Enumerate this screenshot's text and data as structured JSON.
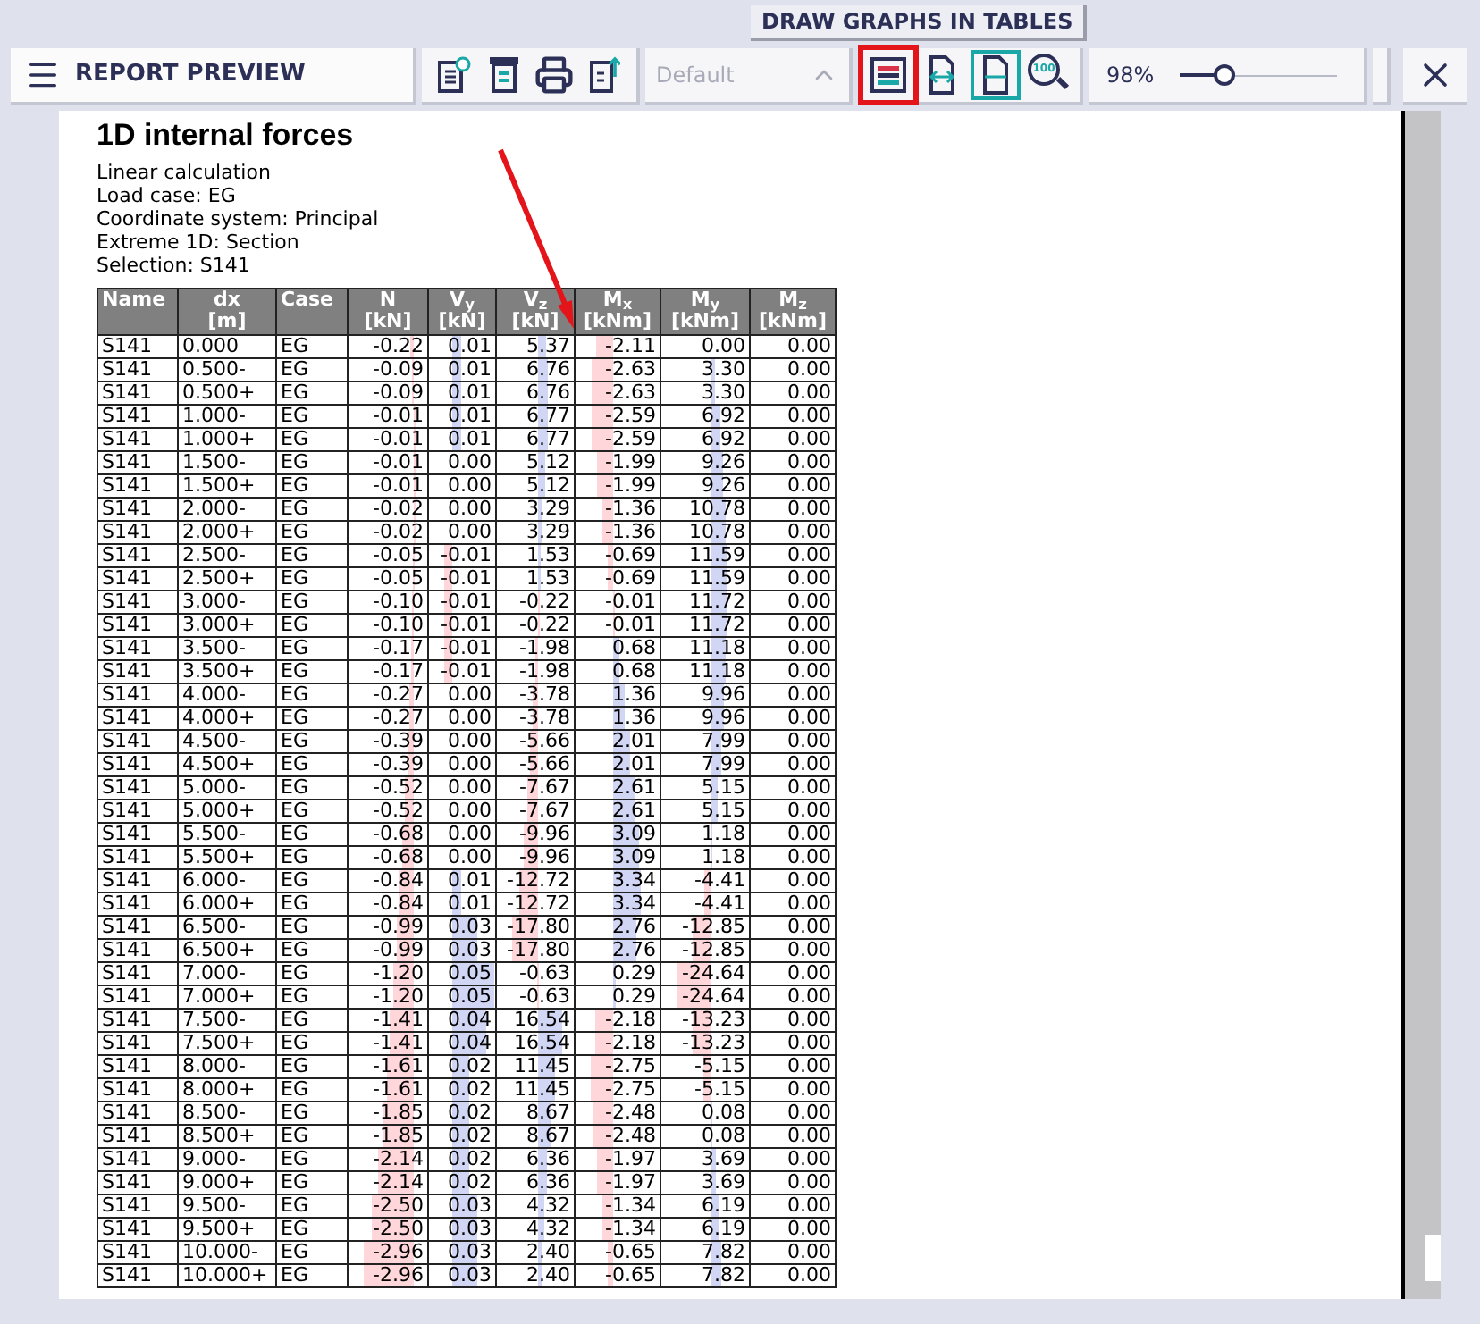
{
  "tooltip": "DRAW GRAPHS IN TABLES",
  "toolbar": {
    "title": "REPORT PREVIEW",
    "file_buttons": [
      {
        "kind": "doc-settings"
      },
      {
        "kind": "table-doc"
      },
      {
        "kind": "print"
      },
      {
        "kind": "export"
      }
    ],
    "template": {
      "value": "Default",
      "disabled": true
    },
    "view_buttons": [
      {
        "kind": "graph-table",
        "selected": false,
        "annotated": true
      },
      {
        "kind": "fit-width",
        "selected": false,
        "annotated": false
      },
      {
        "kind": "fit-page",
        "selected": true,
        "annotated": false
      },
      {
        "kind": "zoom-100",
        "label": "100",
        "selected": false,
        "annotated": false
      }
    ],
    "zoom": {
      "reading": "98%",
      "level": 0.29
    }
  },
  "report": {
    "title": "1D internal forces",
    "info": [
      "Linear calculation",
      "Load case: EG",
      "Coordinate system: Principal",
      "Extreme 1D: Section",
      "Selection: S141"
    ],
    "table": {
      "columns": [
        {
          "name": "Name"
        },
        {
          "name": "dx",
          "unit": "[m]"
        },
        {
          "name": "Case"
        },
        {
          "name": "N",
          "unit": "[kN]"
        },
        {
          "name": "V$_{y}$",
          "unit": "[kN]"
        },
        {
          "name": "V$_{z}$",
          "unit": "[kN]"
        },
        {
          "name": "M$_{x}$",
          "unit": "[kNm]"
        },
        {
          "name": "M$_{y}$",
          "unit": "[kNm]"
        },
        {
          "name": "M$_{z}$",
          "unit": "[kNm]"
        }
      ],
      "rows": [
        [
          "S141",
          "0.000",
          "EG",
          "-0.22",
          "0.01",
          "5.37",
          "-2.11",
          "0.00",
          "0.00"
        ],
        [
          "S141",
          "0.500-",
          "EG",
          "-0.09",
          "0.01",
          "6.76",
          "-2.63",
          "3.30",
          "0.00"
        ],
        [
          "S141",
          "0.500+",
          "EG",
          "-0.09",
          "0.01",
          "6.76",
          "-2.63",
          "3.30",
          "0.00"
        ],
        [
          "S141",
          "1.000-",
          "EG",
          "-0.01",
          "0.01",
          "6.77",
          "-2.59",
          "6.92",
          "0.00"
        ],
        [
          "S141",
          "1.000+",
          "EG",
          "-0.01",
          "0.01",
          "6.77",
          "-2.59",
          "6.92",
          "0.00"
        ],
        [
          "S141",
          "1.500-",
          "EG",
          "-0.01",
          "0.00",
          "5.12",
          "-1.99",
          "9.26",
          "0.00"
        ],
        [
          "S141",
          "1.500+",
          "EG",
          "-0.01",
          "0.00",
          "5.12",
          "-1.99",
          "9.26",
          "0.00"
        ],
        [
          "S141",
          "2.000-",
          "EG",
          "-0.02",
          "0.00",
          "3.29",
          "-1.36",
          "10.78",
          "0.00"
        ],
        [
          "S141",
          "2.000+",
          "EG",
          "-0.02",
          "0.00",
          "3.29",
          "-1.36",
          "10.78",
          "0.00"
        ],
        [
          "S141",
          "2.500-",
          "EG",
          "-0.05",
          "-0.01",
          "1.53",
          "-0.69",
          "11.59",
          "0.00"
        ],
        [
          "S141",
          "2.500+",
          "EG",
          "-0.05",
          "-0.01",
          "1.53",
          "-0.69",
          "11.59",
          "0.00"
        ],
        [
          "S141",
          "3.000-",
          "EG",
          "-0.10",
          "-0.01",
          "-0.22",
          "-0.01",
          "11.72",
          "0.00"
        ],
        [
          "S141",
          "3.000+",
          "EG",
          "-0.10",
          "-0.01",
          "-0.22",
          "-0.01",
          "11.72",
          "0.00"
        ],
        [
          "S141",
          "3.500-",
          "EG",
          "-0.17",
          "-0.01",
          "-1.98",
          "0.68",
          "11.18",
          "0.00"
        ],
        [
          "S141",
          "3.500+",
          "EG",
          "-0.17",
          "-0.01",
          "-1.98",
          "0.68",
          "11.18",
          "0.00"
        ],
        [
          "S141",
          "4.000-",
          "EG",
          "-0.27",
          "0.00",
          "-3.78",
          "1.36",
          "9.96",
          "0.00"
        ],
        [
          "S141",
          "4.000+",
          "EG",
          "-0.27",
          "0.00",
          "-3.78",
          "1.36",
          "9.96",
          "0.00"
        ],
        [
          "S141",
          "4.500-",
          "EG",
          "-0.39",
          "0.00",
          "-5.66",
          "2.01",
          "7.99",
          "0.00"
        ],
        [
          "S141",
          "4.500+",
          "EG",
          "-0.39",
          "0.00",
          "-5.66",
          "2.01",
          "7.99",
          "0.00"
        ],
        [
          "S141",
          "5.000-",
          "EG",
          "-0.52",
          "0.00",
          "-7.67",
          "2.61",
          "5.15",
          "0.00"
        ],
        [
          "S141",
          "5.000+",
          "EG",
          "-0.52",
          "0.00",
          "-7.67",
          "2.61",
          "5.15",
          "0.00"
        ],
        [
          "S141",
          "5.500-",
          "EG",
          "-0.68",
          "0.00",
          "-9.96",
          "3.09",
          "1.18",
          "0.00"
        ],
        [
          "S141",
          "5.500+",
          "EG",
          "-0.68",
          "0.00",
          "-9.96",
          "3.09",
          "1.18",
          "0.00"
        ],
        [
          "S141",
          "6.000-",
          "EG",
          "-0.84",
          "0.01",
          "-12.72",
          "3.34",
          "-4.41",
          "0.00"
        ],
        [
          "S141",
          "6.000+",
          "EG",
          "-0.84",
          "0.01",
          "-12.72",
          "3.34",
          "-4.41",
          "0.00"
        ],
        [
          "S141",
          "6.500-",
          "EG",
          "-0.99",
          "0.03",
          "-17.80",
          "2.76",
          "-12.85",
          "0.00"
        ],
        [
          "S141",
          "6.500+",
          "EG",
          "-0.99",
          "0.03",
          "-17.80",
          "2.76",
          "-12.85",
          "0.00"
        ],
        [
          "S141",
          "7.000-",
          "EG",
          "-1.20",
          "0.05",
          "-0.63",
          "0.29",
          "-24.64",
          "0.00"
        ],
        [
          "S141",
          "7.000+",
          "EG",
          "-1.20",
          "0.05",
          "-0.63",
          "0.29",
          "-24.64",
          "0.00"
        ],
        [
          "S141",
          "7.500-",
          "EG",
          "-1.41",
          "0.04",
          "16.54",
          "-2.18",
          "-13.23",
          "0.00"
        ],
        [
          "S141",
          "7.500+",
          "EG",
          "-1.41",
          "0.04",
          "16.54",
          "-2.18",
          "-13.23",
          "0.00"
        ],
        [
          "S141",
          "8.000-",
          "EG",
          "-1.61",
          "0.02",
          "11.45",
          "-2.75",
          "-5.15",
          "0.00"
        ],
        [
          "S141",
          "8.000+",
          "EG",
          "-1.61",
          "0.02",
          "11.45",
          "-2.75",
          "-5.15",
          "0.00"
        ],
        [
          "S141",
          "8.500-",
          "EG",
          "-1.85",
          "0.02",
          "8.67",
          "-2.48",
          "0.08",
          "0.00"
        ],
        [
          "S141",
          "8.500+",
          "EG",
          "-1.85",
          "0.02",
          "8.67",
          "-2.48",
          "0.08",
          "0.00"
        ],
        [
          "S141",
          "9.000-",
          "EG",
          "-2.14",
          "0.02",
          "6.36",
          "-1.97",
          "3.69",
          "0.00"
        ],
        [
          "S141",
          "9.000+",
          "EG",
          "-2.14",
          "0.02",
          "6.36",
          "-1.97",
          "3.69",
          "0.00"
        ],
        [
          "S141",
          "9.500-",
          "EG",
          "-2.50",
          "0.03",
          "4.32",
          "-1.34",
          "6.19",
          "0.00"
        ],
        [
          "S141",
          "9.500+",
          "EG",
          "-2.50",
          "0.03",
          "4.32",
          "-1.34",
          "6.19",
          "0.00"
        ],
        [
          "S141",
          "10.000-",
          "EG",
          "-2.96",
          "0.03",
          "2.40",
          "-0.65",
          "7.82",
          "0.00"
        ],
        [
          "S141",
          "10.000+",
          "EG",
          "-2.96",
          "0.03",
          "2.40",
          "-0.65",
          "7.82",
          "0.00"
        ]
      ]
    }
  }
}
